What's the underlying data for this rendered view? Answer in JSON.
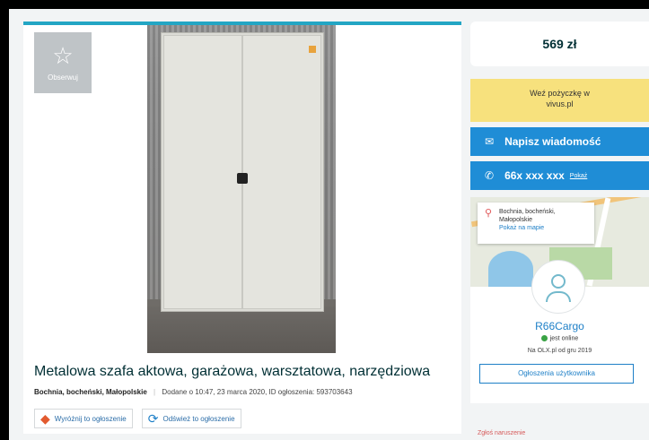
{
  "observe": {
    "label": "Obserwuj",
    "icon": "star-icon"
  },
  "ad": {
    "title": "Metalowa szafa aktowa, garażowa, warsztatowa, narzędziowa",
    "location": "Bochnia, bocheński, Małopolskie",
    "added": "Dodane o 10:47, 23 marca 2020, ID ogłoszenia: 593703643",
    "actions": {
      "promote": "Wyróżnij to ogłoszenie",
      "refresh": "Odśwież to ogłoszenie"
    }
  },
  "sidebar": {
    "price": "569 zł",
    "loan": {
      "line1": "Weź pożyczkę w",
      "line2": "vivus.pl"
    },
    "message_label": "Napisz wiadomość",
    "phone": {
      "number": "66x xxx xxx",
      "show_label": "Pokaż"
    },
    "map_popup": {
      "line1": "Bochnia, bocheński,",
      "line2": "Małopolskie",
      "link": "Pokaż na mapie"
    },
    "user": {
      "name": "R66Cargo",
      "status": "jest online",
      "since": "Na OLX.pl od gru 2019",
      "ads_button": "Ogłoszenia użytkownika"
    },
    "report": "Zgłoś naruszenie"
  },
  "colors": {
    "accent_blue": "#1f8dd6",
    "loan_yellow": "#f7e17d",
    "top_border": "#23a6c4",
    "online_green": "#3aa345"
  }
}
